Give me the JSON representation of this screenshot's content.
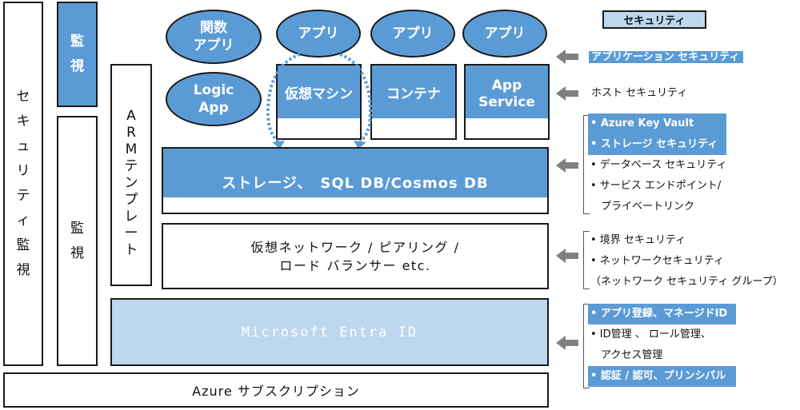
{
  "left_columns": {
    "security_monitoring": [
      "セ",
      "キ",
      "ュ",
      "リ",
      "テ",
      "ィ",
      "監",
      "視"
    ],
    "monitoring_top": [
      "監",
      "視"
    ],
    "monitoring_bottom": [
      "監",
      "視"
    ],
    "arm_template": [
      "A",
      "R",
      "M",
      "テ",
      "ン",
      "プ",
      "レ",
      "ー",
      "ト"
    ]
  },
  "apps": {
    "function_app": "関数\nアプリ",
    "app_vm": "アプリ",
    "app_container": "アプリ",
    "app_service_app": "アプリ",
    "logic_app": "Logic\nApp"
  },
  "hosts": {
    "vm": "仮想マシン",
    "container": "コンテナ",
    "app_service": "App\nService"
  },
  "layers": {
    "storage": "ストレージ、　SQL DB/Cosmos DB",
    "network": "仮想ネットワーク / ピアリング /\nロード バランサー etc.",
    "entra": "Microsoft Entra ID",
    "subscription": "Azure サブスクリプション"
  },
  "security": {
    "title": "セキュリティ",
    "app_security": "アプリケーション セキュリティ",
    "host_security": "ホスト セキュリティ",
    "storage_items": [
      {
        "text": "• Azure Key Vault",
        "highlight": true
      },
      {
        "text": "• ストレージ セキュリティ",
        "highlight": true
      },
      {
        "text": "• データベース セキュリティ",
        "highlight": false
      },
      {
        "text": "• サービス エンドポイント/",
        "highlight": false
      },
      {
        "text": "　プライベートリンク",
        "highlight": false
      }
    ],
    "network_items": [
      {
        "text": "• 境界 セキュリティ",
        "highlight": false
      },
      {
        "text": "• ネットワークセキュリティ",
        "highlight": false
      },
      {
        "text": "（ネットワーク セキュリティ グループ）",
        "highlight": false
      }
    ],
    "identity_items": [
      {
        "text": "• アプリ登録、マネージドID",
        "highlight": true
      },
      {
        "text": "• ID管理 、 ロール管理、",
        "highlight": false
      },
      {
        "text": "　アクセス管理",
        "highlight": false
      },
      {
        "text": "• 認証 / 認可、プリンシパル",
        "highlight": true
      }
    ]
  },
  "colors": {
    "accent_blue": "#5b9bd5",
    "light_blue": "#bdd7ee",
    "arrow_gray": "#808080",
    "border": "#1a1a1a"
  }
}
